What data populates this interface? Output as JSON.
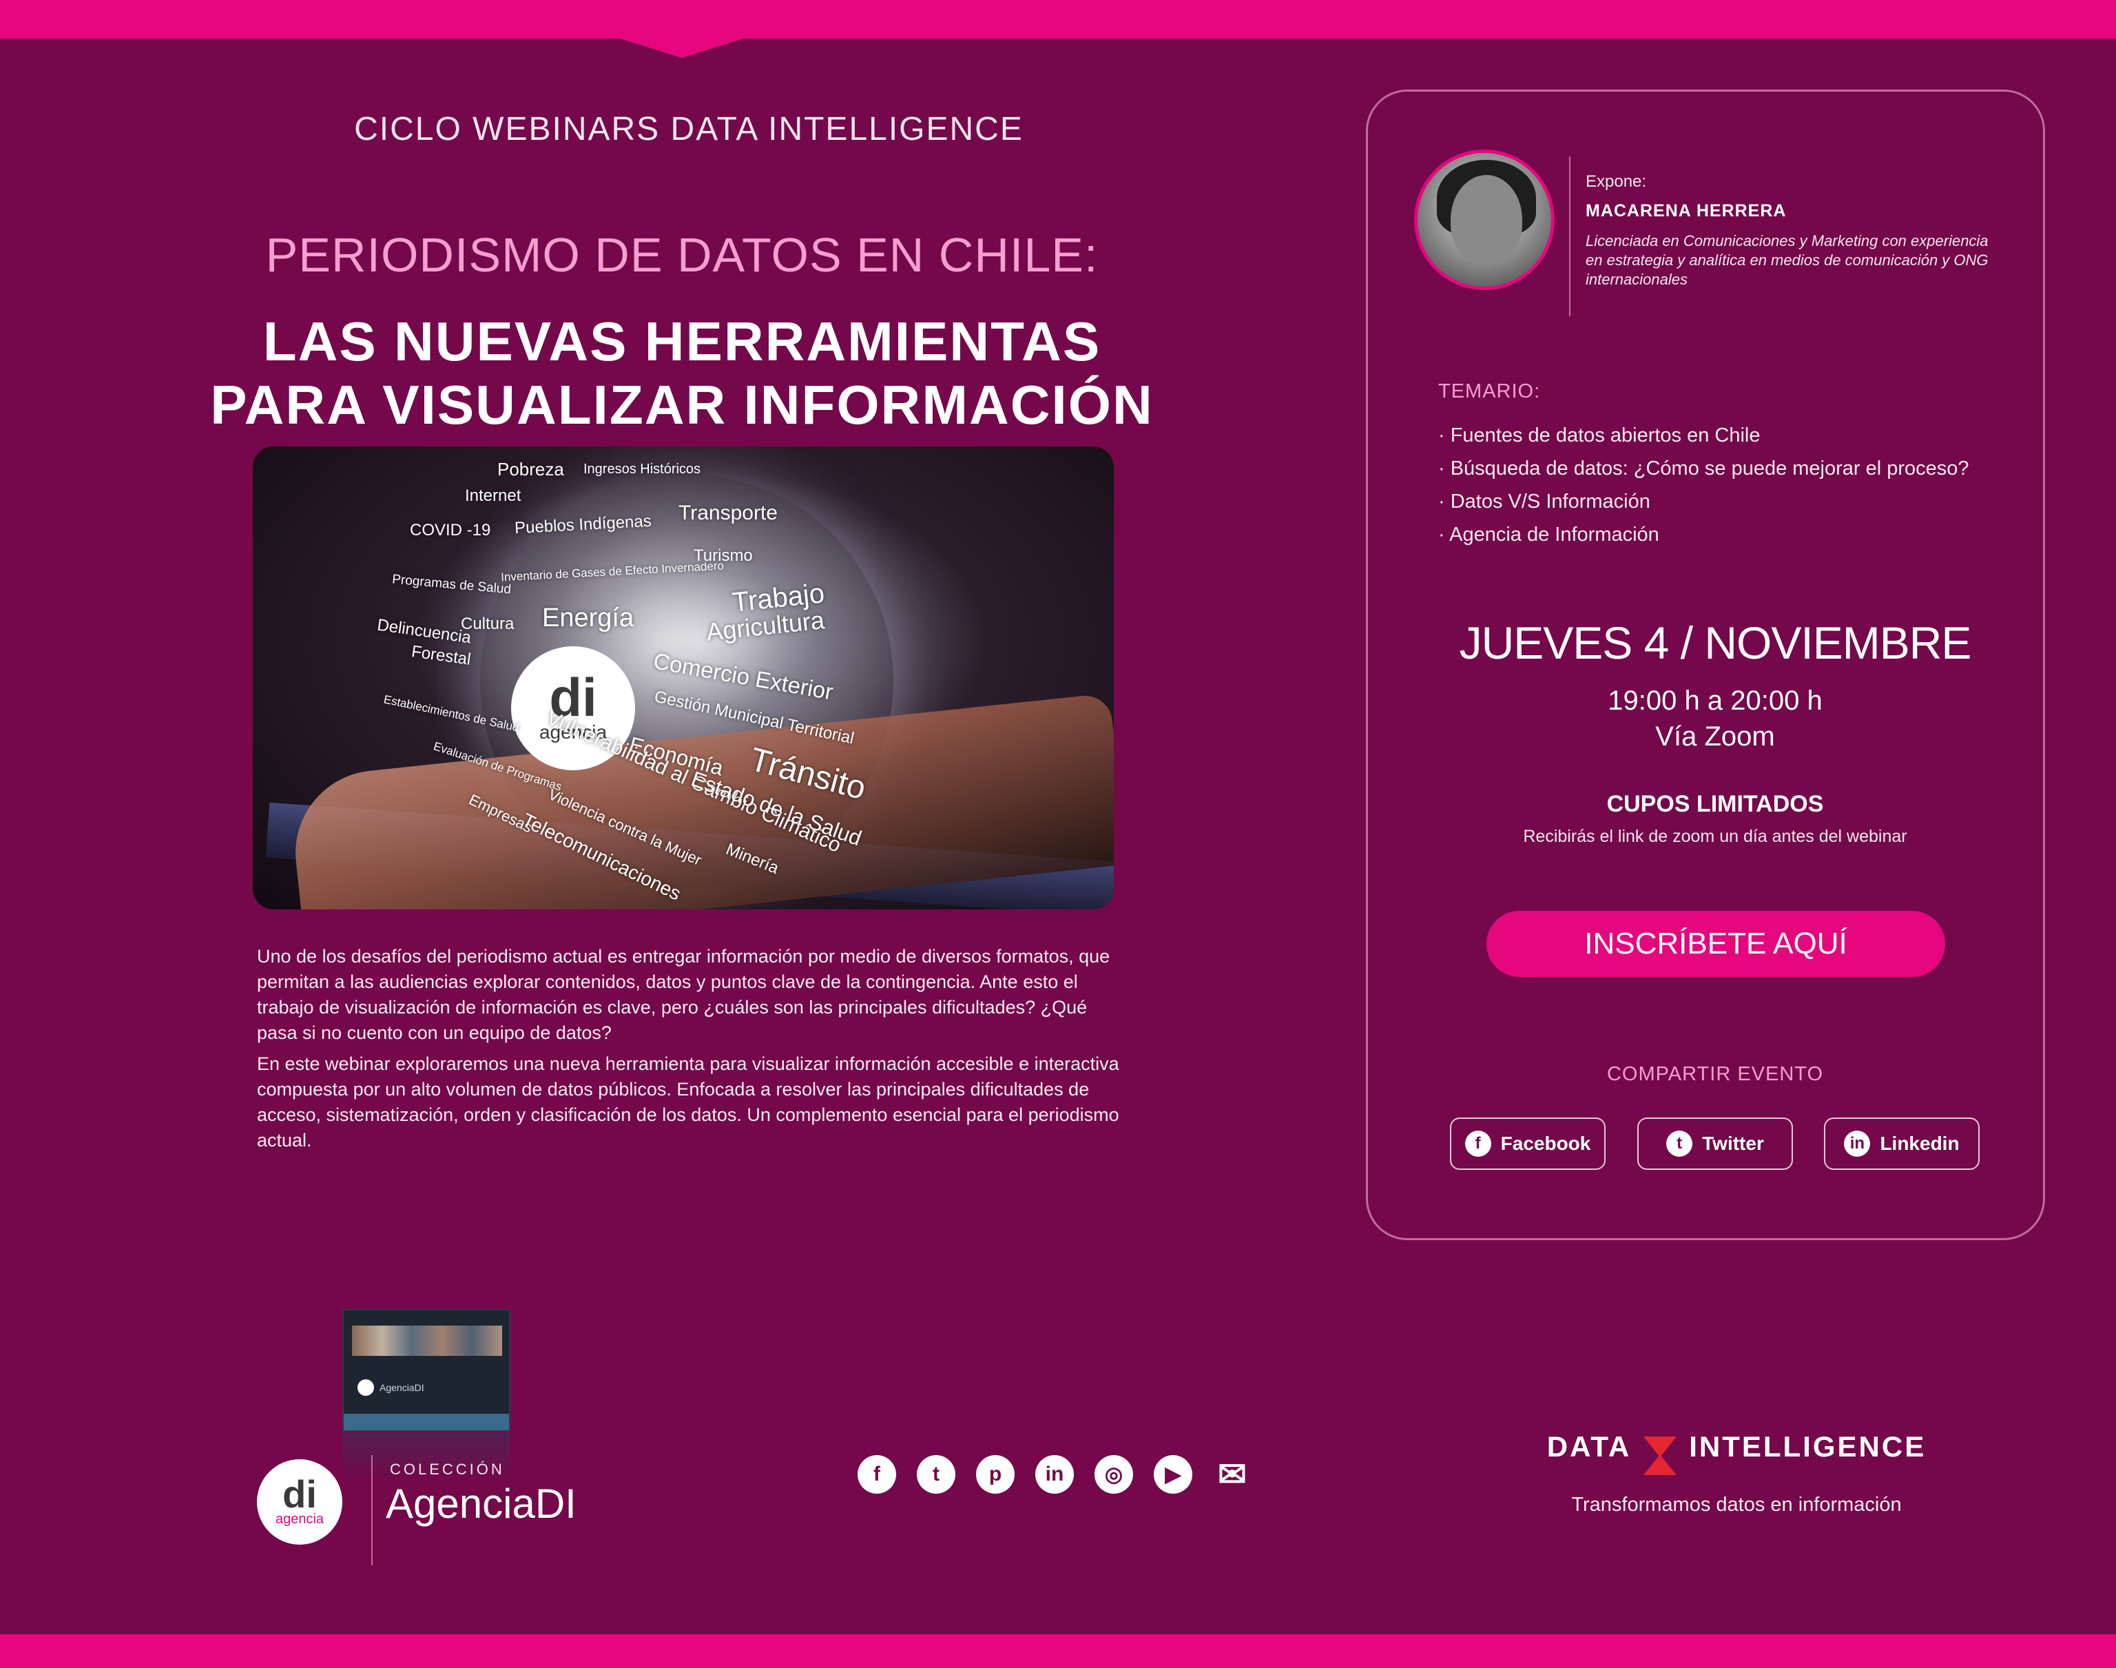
{
  "header": {
    "series": "CICLO WEBINARS DATA INTELLIGENCE",
    "subtitle": "PERIODISMO DE DATOS EN CHILE:",
    "title_line1": "LAS NUEVAS HERRAMIENTAS",
    "title_line2": "PARA VISUALIZAR INFORMACIÓN"
  },
  "hero": {
    "logo_main": "di",
    "logo_sub": "agencia",
    "words": [
      "Pobreza",
      "Ingresos Históricos",
      "Internet",
      "COVID -19",
      "Pueblos Indígenas",
      "Transporte",
      "Inventario de Gases de Efecto Invernadero",
      "Turismo",
      "Programas de Salud",
      "Trabajo",
      "Energía",
      "Agricultura",
      "Cultura",
      "Delincuencia",
      "Forestal",
      "Comercio Exterior",
      "Gestión Municipal Territorial",
      "Establecimientos de Salud",
      "Economía",
      "Tránsito",
      "Evaluación de Programas",
      "Vulnerabilidad al Cambio Climático",
      "Estado de la Salud",
      "Empresas",
      "Violencia contra la Mujer",
      "Minería",
      "Telecomunicaciones"
    ]
  },
  "body": {
    "p1": "Uno de los desafíos del periodismo actual es entregar información por medio de diversos formatos, que permitan a las audiencias explorar contenidos, datos y puntos clave de la contingencia. Ante esto el trabajo de visualización de información es clave, pero ¿cuáles son las principales dificultades? ¿Qué pasa si no cuento con un equipo de datos?",
    "p2": "En este webinar exploraremos una nueva herramienta para visualizar información accesible e interactiva compuesta por un alto volumen de datos públicos. Enfocada a resolver las principales dificultades de acceso, sistematización, orden y clasificación de los datos. Un complemento esencial para el periodismo actual."
  },
  "speaker": {
    "label": "Expone:",
    "name": "MACARENA HERRERA",
    "bio": "Licenciada en Comunicaciones y Marketing con experiencia en estrategia y analítica en medios de comunicación y ONG internacionales"
  },
  "temario": {
    "label": "TEMARIO:",
    "items": [
      "· Fuentes de datos abiertos en Chile",
      "· Búsqueda de datos: ¿Cómo se puede mejorar el proceso?",
      "· Datos V/S Información",
      "· Agencia de Información"
    ]
  },
  "event": {
    "date": "JUEVES 4 / NOVIEMBRE",
    "time": "19:00 h a 20:00 h",
    "via": "Vía Zoom",
    "cupos": "CUPOS LIMITADOS",
    "cupos_note": "Recibirás el link de zoom un día antes del webinar",
    "cta": "INSCRÍBETE AQUÍ"
  },
  "share": {
    "label": "COMPARTIR EVENTO",
    "facebook": "Facebook",
    "twitter": "Twitter",
    "linkedin": "Linkedin"
  },
  "footer": {
    "promo_brand": "AgenciaDI",
    "logo_main": "di",
    "logo_sub": "agencia",
    "coleccion": "COLECCIÓN",
    "coleccion_name": "AgenciaDI",
    "icons": [
      "facebook-icon",
      "twitter-icon",
      "pinterest-icon",
      "linkedin-icon",
      "instagram-icon",
      "youtube-icon",
      "mail-icon"
    ],
    "dil_left": "DATA",
    "dil_right": "INTELLIGENCE",
    "tagline": "Transformamos datos en información"
  },
  "colors": {
    "background": "#74084a",
    "accent": "#e5077e",
    "subtitle_pink": "#f59fd0",
    "logo_red": "#e52630"
  }
}
